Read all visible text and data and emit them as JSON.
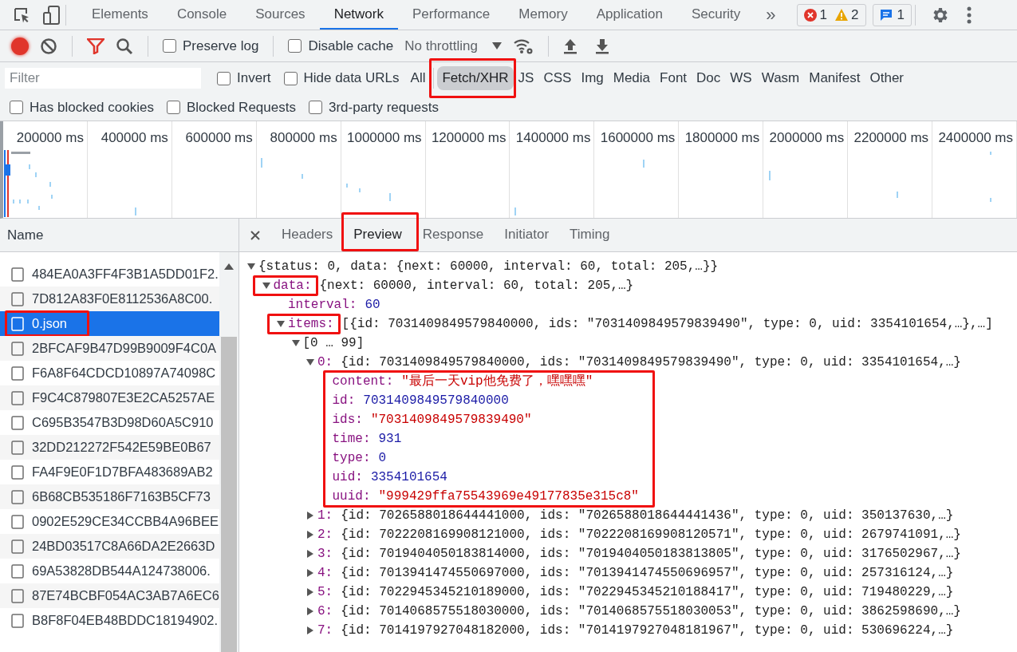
{
  "main_tabs": [
    {
      "label": "Elements",
      "selected": false
    },
    {
      "label": "Console",
      "selected": false
    },
    {
      "label": "Sources",
      "selected": false
    },
    {
      "label": "Network",
      "selected": true
    },
    {
      "label": "Performance",
      "selected": false
    },
    {
      "label": "Memory",
      "selected": false
    },
    {
      "label": "Application",
      "selected": false
    },
    {
      "label": "Security",
      "selected": false
    }
  ],
  "more_tabs": "»",
  "issue_counts": {
    "errors": "1",
    "warnings": "2",
    "messages": "1"
  },
  "toolbar": {
    "recording": true,
    "filter_active": true,
    "options": [
      {
        "label": "Preserve log",
        "checked": false
      },
      {
        "label": "Disable cache",
        "checked": false
      }
    ],
    "throttling": "No throttling"
  },
  "filter": {
    "placeholder": "Filter",
    "options": [
      {
        "label": "Invert",
        "checked": false
      },
      {
        "label": "Hide data URLs",
        "checked": false
      }
    ],
    "types": [
      {
        "label": "All",
        "selected": false,
        "highlighted": false
      },
      {
        "label": "Fetch/XHR",
        "selected": true,
        "highlighted": true
      },
      {
        "label": "JS",
        "selected": false,
        "highlighted": false
      },
      {
        "label": "CSS",
        "selected": false,
        "highlighted": false
      },
      {
        "label": "Img",
        "selected": false,
        "highlighted": false
      },
      {
        "label": "Media",
        "selected": false,
        "highlighted": false
      },
      {
        "label": "Font",
        "selected": false,
        "highlighted": false
      },
      {
        "label": "Doc",
        "selected": false,
        "highlighted": false
      },
      {
        "label": "WS",
        "selected": false,
        "highlighted": false
      },
      {
        "label": "Wasm",
        "selected": false,
        "highlighted": false
      },
      {
        "label": "Manifest",
        "selected": false,
        "highlighted": false
      },
      {
        "label": "Other",
        "selected": false,
        "highlighted": false
      }
    ],
    "more_options": [
      {
        "label": "Has blocked cookies",
        "checked": false
      },
      {
        "label": "Blocked Requests",
        "checked": false
      },
      {
        "label": "3rd-party requests",
        "checked": false
      }
    ]
  },
  "timeline": {
    "ticks": [
      "200000 ms",
      "400000 ms",
      "600000 ms",
      "800000 ms",
      "1000000 ms",
      "1200000 ms",
      "1400000 ms",
      "1600000 ms",
      "1800000 ms",
      "2000000 ms",
      "2200000 ms",
      "2400000 ms"
    ]
  },
  "requests": {
    "column": "Name",
    "rows": [
      {
        "name": "484EA0A3FF4F3B1A5DD01F2.",
        "selected": false,
        "highlighted": false
      },
      {
        "name": "7D812A83F0E8112536A8C00.",
        "selected": false,
        "highlighted": false
      },
      {
        "name": "0.json",
        "selected": true,
        "highlighted": true
      },
      {
        "name": "2BFCAF9B47D99B9009F4C0A",
        "selected": false,
        "highlighted": false
      },
      {
        "name": "F6A8F64CDCD10897A74098C",
        "selected": false,
        "highlighted": false
      },
      {
        "name": "F9C4C879807E3E2CA5257AE",
        "selected": false,
        "highlighted": false
      },
      {
        "name": "C695B3547B3D98D60A5C910",
        "selected": false,
        "highlighted": false
      },
      {
        "name": "32DD212272F542E59BE0B67",
        "selected": false,
        "highlighted": false
      },
      {
        "name": "FA4F9E0F1D7BFA483689AB2",
        "selected": false,
        "highlighted": false
      },
      {
        "name": "6B68CB535186F7163B5CF73",
        "selected": false,
        "highlighted": false
      },
      {
        "name": "0902E529CE34CCBB4A96BEE",
        "selected": false,
        "highlighted": false
      },
      {
        "name": "24BD03517C8A66DA2E2663D",
        "selected": false,
        "highlighted": false
      },
      {
        "name": "69A53828DB544A124738006.",
        "selected": false,
        "highlighted": false
      },
      {
        "name": "87E74BCBF054AC3AB7A6EC6",
        "selected": false,
        "highlighted": false
      },
      {
        "name": "B8F8F04EB48BDDC18194902.",
        "selected": false,
        "highlighted": false
      }
    ]
  },
  "detail_tabs": [
    {
      "label": "Headers",
      "selected": false,
      "highlighted": false
    },
    {
      "label": "Preview",
      "selected": true,
      "highlighted": true
    },
    {
      "label": "Response",
      "selected": false,
      "highlighted": false
    },
    {
      "label": "Initiator",
      "selected": false,
      "highlighted": false
    },
    {
      "label": "Timing",
      "selected": false,
      "highlighted": false
    }
  ],
  "preview": {
    "kind": "object",
    "value": "{status: 0, data: {next: 60000, interval: 60, total: 205,…}}",
    "expanded": true,
    "children": [
      {
        "key": "data:",
        "kind": "object",
        "value": "{next: 60000, interval: 60, total: 205,…}",
        "expanded": true,
        "highlighted": true,
        "children": [
          {
            "key": "interval:",
            "kind": "number",
            "value": "60"
          },
          {
            "key": "items:",
            "kind": "object",
            "value": "[{id: 7031409849579840000, ids: \"7031409849579839490\", type: 0, uid: 3354101654,…},…]",
            "expanded": true,
            "highlighted": true,
            "children": [
              {
                "kind": "object",
                "value": "[0 … 99]",
                "expanded": true,
                "children": [
                  {
                    "key": "0:",
                    "kind": "object",
                    "value": "{id: 7031409849579840000, ids: \"7031409849579839490\", type: 0, uid: 3354101654,…}",
                    "expanded": true,
                    "children_highlighted": true,
                    "children": [
                      {
                        "key": "content:",
                        "kind": "string",
                        "value": "\"最后一天vip他免费了，嘿嘿嘿\""
                      },
                      {
                        "key": "id:",
                        "kind": "number",
                        "value": "7031409849579840000"
                      },
                      {
                        "key": "ids:",
                        "kind": "string",
                        "value": "\"7031409849579839490\""
                      },
                      {
                        "key": "time:",
                        "kind": "number",
                        "value": "931"
                      },
                      {
                        "key": "type:",
                        "kind": "number",
                        "value": "0"
                      },
                      {
                        "key": "uid:",
                        "kind": "number",
                        "value": "3354101654"
                      },
                      {
                        "key": "uuid:",
                        "kind": "string",
                        "value": "\"999429ffa75543969e49177835e315c8\""
                      }
                    ]
                  },
                  {
                    "key": "1:",
                    "kind": "object",
                    "value": "{id: 7026588018644441000, ids: \"7026588018644441436\", type: 0, uid: 350137630,…}",
                    "expanded": false
                  },
                  {
                    "key": "2:",
                    "kind": "object",
                    "value": "{id: 7022208169908121000, ids: \"7022208169908120571\", type: 0, uid: 2679741091,…}",
                    "expanded": false
                  },
                  {
                    "key": "3:",
                    "kind": "object",
                    "value": "{id: 7019404050183814000, ids: \"7019404050183813805\", type: 0, uid: 3176502967,…}",
                    "expanded": false
                  },
                  {
                    "key": "4:",
                    "kind": "object",
                    "value": "{id: 7013941474550697000, ids: \"7013941474550696957\", type: 0, uid: 257316124,…}",
                    "expanded": false
                  },
                  {
                    "key": "5:",
                    "kind": "object",
                    "value": "{id: 7022945345210189000, ids: \"7022945345210188417\", type: 0, uid: 719480229,…}",
                    "expanded": false
                  },
                  {
                    "key": "6:",
                    "kind": "object",
                    "value": "{id: 7014068575518030000, ids: \"7014068575518030053\", type: 0, uid: 3862598690,…}",
                    "expanded": false
                  },
                  {
                    "key": "7:",
                    "kind": "object",
                    "value": "{id: 7014197927048182000, ids: \"7014197927048181967\", type: 0, uid: 530696224,…}",
                    "expanded": false
                  }
                ]
              }
            ]
          }
        ]
      }
    ]
  }
}
